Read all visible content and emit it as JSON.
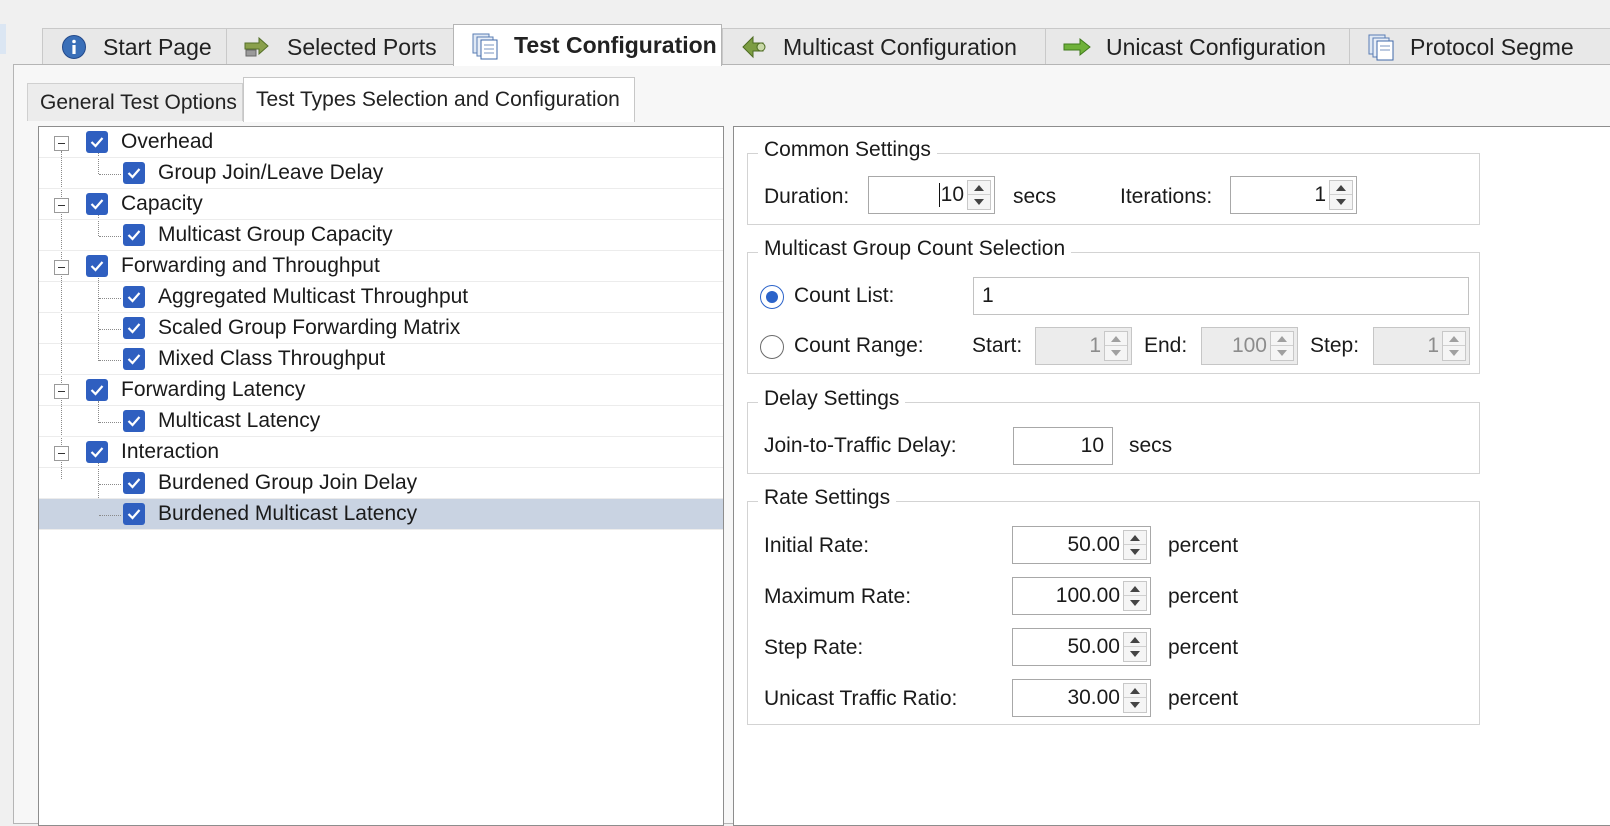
{
  "main_tabs": [
    {
      "label": "Start Page",
      "icon": "info-icon"
    },
    {
      "label": "Selected Ports",
      "icon": "ports-arrows-icon"
    },
    {
      "label": "Test Configuration",
      "icon": "document-stack-icon",
      "active": true
    },
    {
      "label": "Multicast Configuration",
      "icon": "multicast-arrows-icon"
    },
    {
      "label": "Unicast Configuration",
      "icon": "green-arrow-icon"
    },
    {
      "label": "Protocol Segme",
      "icon": "document-stack-icon"
    }
  ],
  "sub_tabs": [
    {
      "label": "General Test Options"
    },
    {
      "label": "Test Types Selection and Configuration",
      "active": true
    }
  ],
  "tree": [
    {
      "label": "Overhead",
      "level": 0,
      "checked": true
    },
    {
      "label": "Group Join/Leave Delay",
      "level": 1,
      "checked": true
    },
    {
      "label": "Capacity",
      "level": 0,
      "checked": true
    },
    {
      "label": "Multicast Group Capacity",
      "level": 1,
      "checked": true
    },
    {
      "label": "Forwarding and Throughput",
      "level": 0,
      "checked": true
    },
    {
      "label": "Aggregated Multicast Throughput",
      "level": 1,
      "checked": true
    },
    {
      "label": "Scaled Group Forwarding Matrix",
      "level": 1,
      "checked": true
    },
    {
      "label": "Mixed Class Throughput",
      "level": 1,
      "checked": true
    },
    {
      "label": "Forwarding Latency",
      "level": 0,
      "checked": true
    },
    {
      "label": "Multicast Latency",
      "level": 1,
      "checked": true
    },
    {
      "label": "Interaction",
      "level": 0,
      "checked": true
    },
    {
      "label": "Burdened Group Join Delay",
      "level": 1,
      "checked": true
    },
    {
      "label": "Burdened Multicast Latency",
      "level": 1,
      "checked": true,
      "selected": true
    }
  ],
  "common_settings": {
    "title": "Common Settings",
    "duration_label": "Duration:",
    "duration_value": "10",
    "duration_unit": "secs",
    "iterations_label": "Iterations:",
    "iterations_value": "1"
  },
  "group_count": {
    "title": "Multicast Group Count Selection",
    "count_list_label": "Count List:",
    "count_list_value": "1",
    "count_list_selected": true,
    "count_range_label": "Count Range:",
    "start_label": "Start:",
    "start_value": "1",
    "end_label": "End:",
    "end_value": "100",
    "step_label": "Step:",
    "step_value": "1"
  },
  "delay_settings": {
    "title": "Delay Settings",
    "join_label": "Join-to-Traffic Delay:",
    "join_value": "10",
    "join_unit": "secs"
  },
  "rate_settings": {
    "title": "Rate Settings",
    "unit": "percent",
    "rows": [
      {
        "label": "Initial Rate:",
        "value": "50.00"
      },
      {
        "label": "Maximum Rate:",
        "value": "100.00"
      },
      {
        "label": "Step Rate:",
        "value": "50.00"
      },
      {
        "label": "Unicast Traffic Ratio:",
        "value": "30.00"
      }
    ]
  },
  "colors": {
    "checkbox": "#2f5fc0",
    "selection": "#c9d3e2",
    "radio_accent": "#2b63c9"
  }
}
